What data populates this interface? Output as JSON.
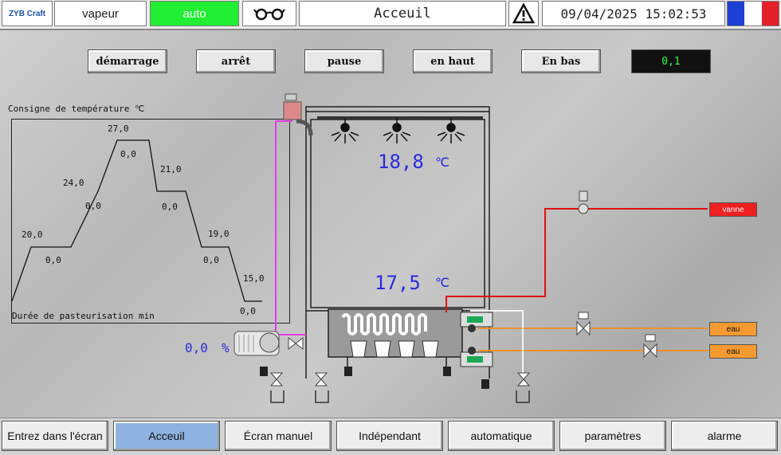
{
  "header": {
    "logo": "ZYB Craft",
    "mode": "vapeur",
    "status": "auto",
    "title": "Acceuil",
    "datetime": "09/04/2025 15:02:53",
    "status_color": "#22ee33"
  },
  "controls": {
    "start": "démarrage",
    "stop": "arrêt",
    "pause": "pause",
    "up": "en haut",
    "down": "En bas",
    "counter": "0,1"
  },
  "profile": {
    "title": "Consigne de température ℃",
    "footer": "Durée de pasteurisation min",
    "temps": [
      "20,0",
      "24,0",
      "27,0",
      "21,0",
      "19,0",
      "15,0"
    ],
    "times": [
      "0,0",
      "0,0",
      "0,0",
      "0,0",
      "0,0",
      "0,0"
    ]
  },
  "process": {
    "temp_top": "18,8",
    "temp_bottom": "17,5",
    "unit": "℃",
    "motor_value": "0,0",
    "motor_unit": "%",
    "valve_label": "vanne",
    "water_label_1": "eau",
    "water_label_2": "eau"
  },
  "nav": [
    "Entrez dans l'écran",
    "Acceuil",
    "Écran manuel",
    "Indépendant",
    "automatique",
    "paramètres",
    "alarme"
  ]
}
